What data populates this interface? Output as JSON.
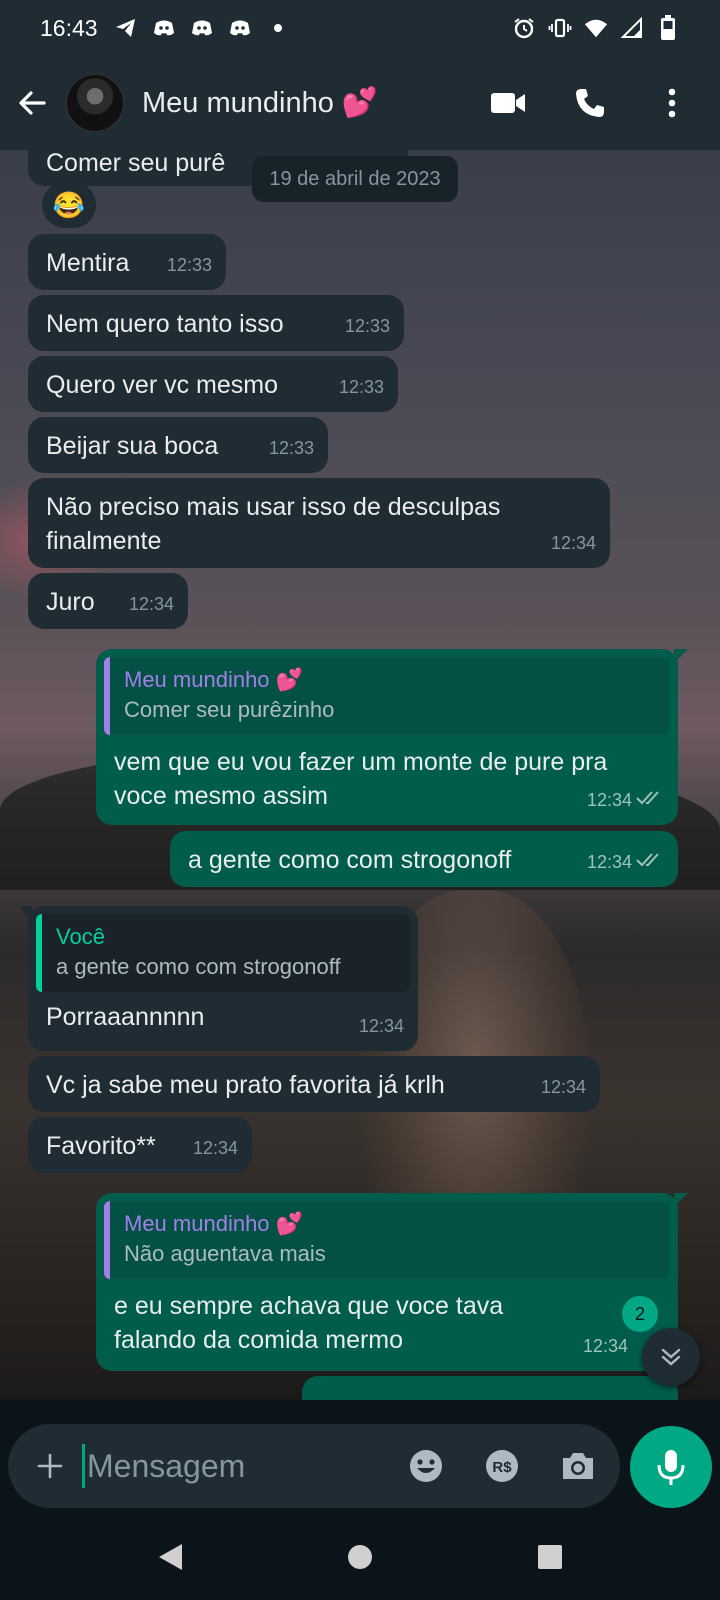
{
  "status_bar": {
    "time": "16:43",
    "left_icons": [
      "telegram-icon",
      "discord-icon",
      "discord-icon",
      "discord-icon",
      "dot-icon"
    ],
    "right_icons": [
      "alarm-icon",
      "vibrate-icon",
      "wifi-icon",
      "signal-icon",
      "battery-icon"
    ]
  },
  "header": {
    "contact_name": "Meu mundinho 💕",
    "actions": [
      "video-call-icon",
      "voice-call-icon",
      "more-options-icon"
    ]
  },
  "chat": {
    "partial_message": "Comer seu purê",
    "date_chip": "19 de abril de 2023",
    "reaction_emoji": "😂",
    "messages": [
      {
        "dir": "in",
        "text": "Mentira",
        "time": "12:33"
      },
      {
        "dir": "in",
        "text": "Nem quero tanto isso",
        "time": "12:33"
      },
      {
        "dir": "in",
        "text": "Quero ver vc mesmo",
        "time": "12:33"
      },
      {
        "dir": "in",
        "text": "Beijar sua boca",
        "time": "12:33"
      },
      {
        "dir": "in",
        "text": "Não preciso mais usar isso de desculpas finalmente",
        "time": "12:34"
      },
      {
        "dir": "in",
        "text": "Juro",
        "time": "12:34"
      },
      {
        "dir": "out",
        "quote_author": "Meu mundinho 💕",
        "quote_text": "Comer seu purêzinho",
        "text": "vem que eu vou fazer um monte de pure pra voce mesmo assim",
        "time": "12:34",
        "status": "read"
      },
      {
        "dir": "out",
        "text": "a gente como com strogonoff",
        "time": "12:34",
        "status": "read"
      },
      {
        "dir": "in",
        "quote_author": "Você",
        "quote_text": "a gente como com strogonoff",
        "text": "Porraaannnnn",
        "time": "12:34"
      },
      {
        "dir": "in",
        "text": "Vc ja sabe meu prato favorita já krlh",
        "time": "12:34"
      },
      {
        "dir": "in",
        "text": "Favorito**",
        "time": "12:34"
      },
      {
        "dir": "out",
        "quote_author": "Meu mundinho 💕",
        "quote_text": "Não aguentava mais",
        "text": "e eu sempre achava que voce tava falando da comida mermo",
        "time": "12:34",
        "status": "read"
      }
    ],
    "unread_count": "2"
  },
  "composer": {
    "placeholder": "Mensagem",
    "icons": [
      "add-icon",
      "emoji-icon",
      "payment-icon",
      "camera-icon",
      "mic-icon"
    ]
  },
  "colors": {
    "header_bg": "#1f2c33",
    "incoming_bubble": "#202c33",
    "outgoing_bubble": "#005c4b",
    "accent": "#00a884",
    "read_ticks": "#9fc2b9"
  }
}
